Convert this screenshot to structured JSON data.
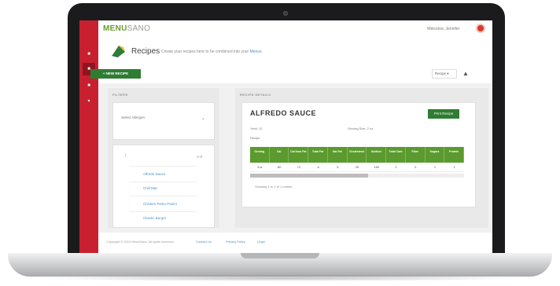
{
  "app": {
    "logo_main": "MENU",
    "logo_suffix": "SANO",
    "user_name": "Welcome, Jennifer"
  },
  "header": {
    "title": "Recipes",
    "subtitle": "Create your recipes here to be combined into your ",
    "subtitle_link": "Menus"
  },
  "toolbar": {
    "create_label": "+ NEW RECIPE",
    "select_value": "Recipe ▾"
  },
  "left_panel": {
    "heading": "FILTERS",
    "filter_placeholder": "Select Allergen",
    "list_header": "A-Z",
    "items": [
      "Alfredo Sauce",
      "Chili Mac",
      "Chicken Pesto Panini",
      "Classic Burger"
    ]
  },
  "right_panel": {
    "heading": "RECIPE DETAILS",
    "recipe_title": "ALFREDO SAUCE",
    "print_label": "Print Recipe",
    "meta_left": "Yield: 12",
    "meta_right": "Serving Size: 2 oz",
    "meta_sub": "Recipe",
    "table_headers": [
      "Serving",
      "Cal",
      "Cal from Fat",
      "Total Fat",
      "Sat Fat",
      "Cholesterol",
      "Sodium",
      "Total Carb",
      "Fiber",
      "Sugars",
      "Protein"
    ],
    "table_row": [
      "2oz",
      "80",
      "72",
      "8",
      "5",
      "25",
      "180",
      "2",
      "0",
      "1",
      "1"
    ],
    "showing_text": "Showing 1 to 1 of 1 entries"
  },
  "footer": {
    "copyright": "Copyright © 2015 MenuSano. All rights reserved.",
    "links": [
      "Contact Us",
      "Privacy Policy",
      "Legal"
    ]
  },
  "colors": {
    "brand_red": "#c8202f",
    "brand_green": "#2e7d32",
    "table_green": "#5b9a2e"
  }
}
